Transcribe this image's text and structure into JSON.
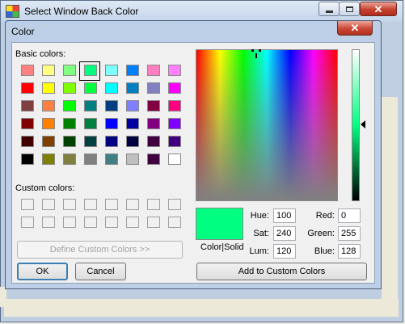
{
  "outer": {
    "title": "Select Window Back Color"
  },
  "dialog": {
    "title": "Color"
  },
  "basic_colors": {
    "label": "Basic colors:",
    "swatches": [
      "#ff8080",
      "#ffff80",
      "#80ff80",
      "#00ff80",
      "#80ffff",
      "#0080ff",
      "#ff80c0",
      "#ff80ff",
      "#ff0000",
      "#ffff00",
      "#80ff00",
      "#00ff40",
      "#00ffff",
      "#0080c0",
      "#8080c0",
      "#ff00ff",
      "#804040",
      "#ff8040",
      "#00ff00",
      "#008080",
      "#004080",
      "#8080ff",
      "#800040",
      "#ff0080",
      "#800000",
      "#ff8000",
      "#008000",
      "#008040",
      "#0000ff",
      "#0000a0",
      "#800080",
      "#8000ff",
      "#400000",
      "#804000",
      "#004000",
      "#004040",
      "#000080",
      "#000040",
      "#400040",
      "#400080",
      "#000000",
      "#808000",
      "#808040",
      "#808080",
      "#408080",
      "#c0c0c0",
      "#400040",
      "#ffffff"
    ],
    "selected_index": 3
  },
  "custom_colors": {
    "label": "Custom colors:"
  },
  "buttons": {
    "define_custom": "Define Custom Colors >>",
    "ok": "OK",
    "cancel": "Cancel",
    "add_custom": "Add to Custom Colors"
  },
  "preview": {
    "color": "#00ff80",
    "label": "Color|Solid"
  },
  "fields": {
    "hue_label": "Hue:",
    "hue": "100",
    "sat_label": "Sat:",
    "sat": "240",
    "lum_label": "Lum:",
    "lum": "120",
    "red_label": "Red:",
    "red": "0",
    "green_label": "Green:",
    "green": "255",
    "blue_label": "Blue:",
    "blue": "128"
  }
}
